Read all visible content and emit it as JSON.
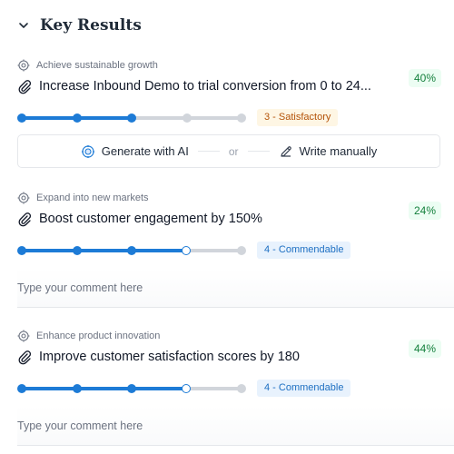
{
  "header": {
    "title": "Key Results"
  },
  "key_results": [
    {
      "objective": "Achieve sustainable growth",
      "title": "Increase Inbound Demo to trial conversion from 0 to 24...",
      "percent": "40%",
      "rating": "3 - Satisfactory",
      "rating_level": 3,
      "rating_scale": 5
    },
    {
      "objective": "Expand into new markets",
      "title": "Boost customer engagement by 150%",
      "percent": "24%",
      "rating": "4 - Commendable",
      "rating_level": 4,
      "rating_scale": 5
    },
    {
      "objective": "Enhance product innovation",
      "title": "Improve customer satisfaction scores by 180",
      "percent": "44%",
      "rating": "4 - Commendable",
      "rating_level": 4,
      "rating_scale": 5
    }
  ],
  "generate": {
    "ai_label": "Generate with AI",
    "or_label": "or",
    "manual_label": "Write manually"
  },
  "comments": {
    "placeholder": "Type your comment here"
  },
  "icons": {
    "collapse": "chevron-down-icon",
    "objective": "target-icon",
    "key_result": "paperclip-icon",
    "ai": "sparkle-target-icon",
    "manual": "pencil-icon"
  },
  "colors": {
    "primary": "#1d7bd6",
    "success": "#15803d",
    "warning": "#b45309"
  }
}
